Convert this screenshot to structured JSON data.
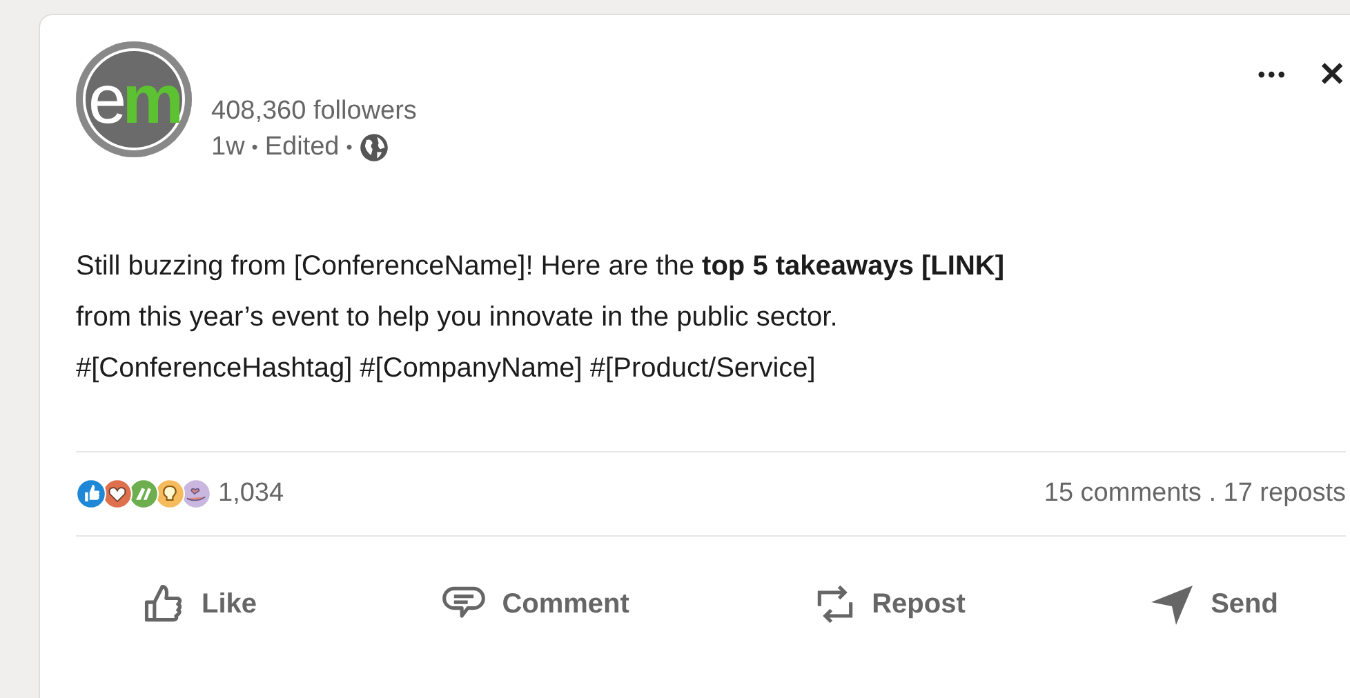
{
  "post": {
    "logo": {
      "parts": [
        {
          "text": "e"
        },
        {
          "text": "m"
        }
      ]
    },
    "followers": "408,360 followers",
    "meta": {
      "age": "1w",
      "edited": "Edited",
      "separator": "•"
    },
    "menu_icon": "•••",
    "close_icon": "✕",
    "text_lines": [
      "Still buzzing from [ConferenceName]! Here are the **top 5 takeaways [LINK]**",
      "from this year’s event to help you innovate in the public sector.",
      "#[ConferenceHashtag] #[CompanyName] #[Product/Service]"
    ],
    "reactions": [
      {
        "kind": "like"
      },
      {
        "kind": "love"
      },
      {
        "kind": "celebrate"
      },
      {
        "kind": "insightful"
      },
      {
        "kind": "support"
      }
    ],
    "reaction_count": "1,034",
    "comments_reposts": "15 comments . 17 reposts",
    "actions": [
      {
        "kind": "like",
        "label": "Like"
      },
      {
        "kind": "comment",
        "label": "Comment"
      },
      {
        "kind": "repost",
        "label": "Repost"
      },
      {
        "kind": "send",
        "label": "Send"
      }
    ]
  }
}
